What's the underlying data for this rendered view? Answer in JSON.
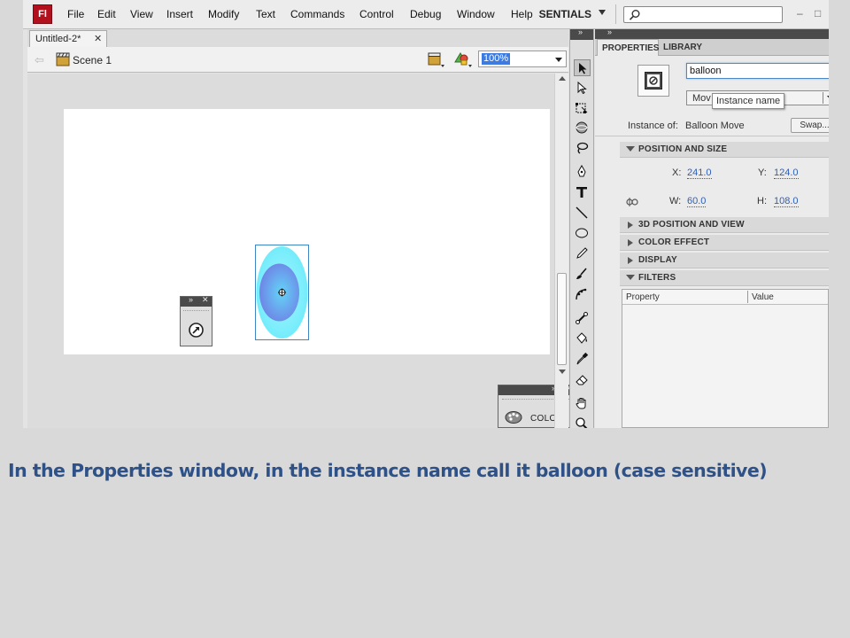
{
  "app": {
    "logo": "Fl"
  },
  "menu": [
    "File",
    "Edit",
    "View",
    "Insert",
    "Modify",
    "Text",
    "Commands",
    "Control",
    "Debug",
    "Window",
    "Help"
  ],
  "workspace": {
    "label": "ESSENTIALS",
    "icon": "chevron-down-icon"
  },
  "search": {
    "icon": "search-icon",
    "value": ""
  },
  "window_controls": {
    "minimize": "–",
    "maximize": "□"
  },
  "document": {
    "tab_label": "Untitled-2*",
    "tab_close": "✕",
    "scene_label": "Scene 1",
    "zoom": "100%"
  },
  "stage": {
    "background": "#ffffff",
    "pasteboard": "#dcdcdc",
    "balloon_colors": {
      "outer": "#7ff0fb",
      "inner": "#6f86e6",
      "highlight": "#5fd3f5"
    }
  },
  "panels": {
    "color_panel_label": "COLOR"
  },
  "properties": {
    "tabs": [
      "PROPERTIES",
      "LIBRARY"
    ],
    "instance_name": "balloon",
    "instance_type": "Mov",
    "tooltip": "Instance name",
    "instance_of_label": "Instance of:",
    "instance_of_value": "Balloon Move",
    "swap_button": "Swap...",
    "sections": {
      "position_and_size": "POSITION AND SIZE",
      "position_3d": "3D POSITION AND VIEW",
      "color_effect": "COLOR EFFECT",
      "display": "DISPLAY",
      "filters": "FILTERS"
    },
    "x_label": "X:",
    "x_value": "241.0",
    "y_label": "Y:",
    "y_value": "124.0",
    "w_label": "W:",
    "w_value": "60.0",
    "h_label": "H:",
    "h_value": "108.0",
    "filters_columns": [
      "Property",
      "Value"
    ]
  },
  "caption": "In the Properties window, in the instance name call it balloon (case sensitive)",
  "colors": {
    "caption": "#2e5188",
    "accent": "#3d7be0",
    "logo": "#b3101e"
  }
}
